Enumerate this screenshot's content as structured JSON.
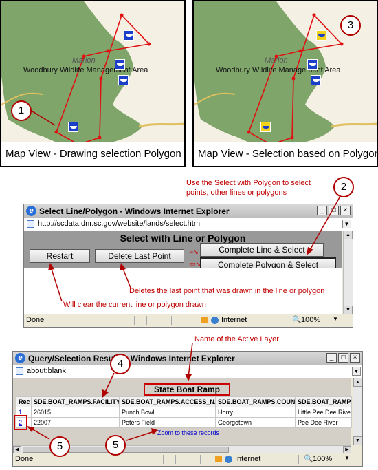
{
  "map1": {
    "sub": "Marion",
    "label": "Woodbury Wildlife Management Area",
    "caption": "Map View - Drawing selection Polygon",
    "callout": "1"
  },
  "map2": {
    "sub": "Marion",
    "label": "Woodbury Wildlife Management Area",
    "caption": "Map View - Selection based on Polygon",
    "callout": "3"
  },
  "note_select": "Use the Select with Polygon to select points, other lines or polygons",
  "callout2": "2",
  "win1": {
    "title": "Select Line/Polygon - Windows Internet Explorer",
    "url": "http://scdata.dnr.sc.gov/website/lands/select.htm",
    "heading": "Select with Line or Polygon",
    "btn_restart": "Restart",
    "btn_delete": "Delete Last Point",
    "btn_line": "Complete Line & Select",
    "btn_polygon": "Complete Polygon & Select",
    "status": "Done",
    "zone": "Internet",
    "zoom": "100%"
  },
  "note_delete": "Deletes the last point that was drawn in the line or polygon",
  "note_clear": "Will clear the current line or polygon drawn",
  "note_layer": "Name of the Active Layer",
  "callout4": "4",
  "callout5a": "5",
  "callout5b": "5",
  "win2": {
    "title": "Query/Selection Results - Windows Internet Explorer",
    "url": "about:blank",
    "layer": "State Boat Ramp",
    "columns": [
      "Rec",
      "SDE.BOAT_RAMPS.FACILITYID",
      "SDE.BOAT_RAMPS.ACCESS_NAM",
      "SDE.BOAT_RAMPS.COUNTY",
      "SDE.BOAT_RAMPS"
    ],
    "rows": [
      [
        "1",
        "26015",
        "Punch Bowl",
        "Horry",
        "Little Pee Dee River"
      ],
      [
        "2",
        "22007",
        "Peters Field",
        "Georgetown",
        "Pee Dee River"
      ]
    ],
    "zoom_link": "Zoom to these records",
    "status": "Done",
    "zone": "Internet",
    "zoom": "100%"
  }
}
